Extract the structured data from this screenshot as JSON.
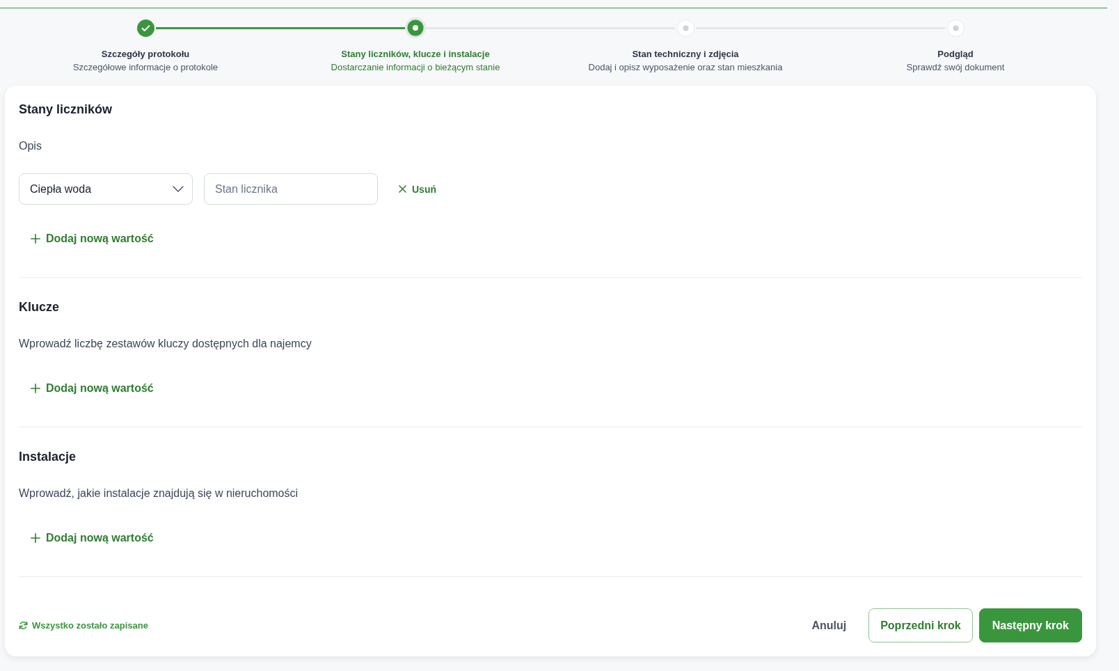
{
  "steps": [
    {
      "title": "Szczegóły protokołu",
      "subtitle": "Szczegółowe informacje o protokole",
      "completed": true,
      "selected": false
    },
    {
      "title": "Stany liczników, klucze i instalacje",
      "subtitle": "Dostarczanie informacji o bieżącym stanie",
      "completed": false,
      "selected": true
    },
    {
      "title": "Stan techniczny i zdjęcia",
      "subtitle": "Dodaj i opisz wyposażenie oraz stan mieszkania",
      "completed": false,
      "selected": false
    },
    {
      "title": "Podgląd",
      "subtitle": "Sprawdź swój dokument",
      "completed": false,
      "selected": false
    }
  ],
  "sections": [
    {
      "title": "Stany liczników",
      "description": "Opis",
      "rows": [
        {
          "select": {
            "value": "Ciepła woda"
          },
          "input": {
            "placeholder": "Stan licznika"
          },
          "remove_label": "Usuń"
        }
      ],
      "add_label": "Dodaj nową wartość"
    },
    {
      "title": "Klucze",
      "description": "Wprowadź liczbę zestawów kluczy dostępnych dla najemcy",
      "add_label": "Dodaj nową wartość"
    },
    {
      "title": "Instalacje",
      "description": "Wprowadź, jakie instalacje znajdują się w nieruchomości",
      "add_label": "Dodaj nową wartość"
    }
  ],
  "footer": {
    "save_status": "Wszystko zostało zapisane",
    "buttons": [
      {
        "label": "Anuluj",
        "kind": "text"
      },
      {
        "label": "Poprzedni krok",
        "kind": "outline"
      },
      {
        "label": "Następny krok",
        "kind": "primary"
      }
    ]
  }
}
